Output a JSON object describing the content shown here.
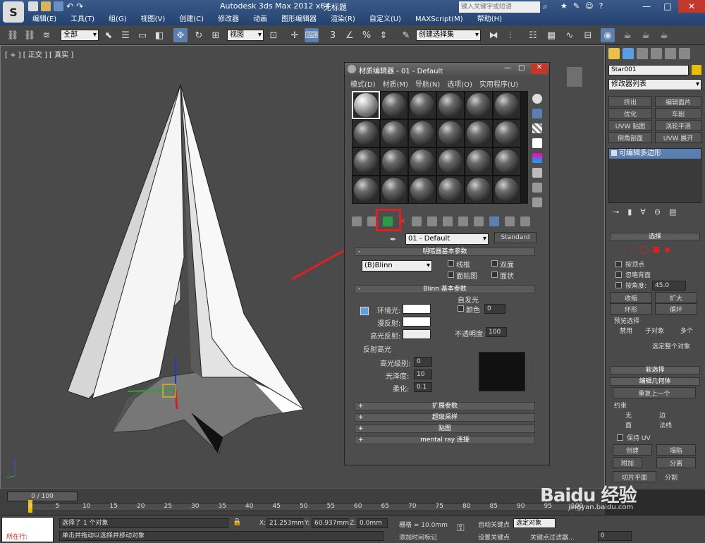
{
  "app": {
    "title": "Autodesk 3ds Max  2012 x64",
    "doc_title": "无标题",
    "search_placeholder": "键入关键字或短语"
  },
  "menu": [
    "编辑(E)",
    "工具(T)",
    "组(G)",
    "视图(V)",
    "创建(C)",
    "修改器",
    "动画",
    "图形编辑器",
    "渲染(R)",
    "自定义(U)",
    "MAXScript(M)",
    "帮助(H)"
  ],
  "toolbar": {
    "selection_filter": "全部",
    "coord_system": "视图",
    "selection_set": "创建选择集"
  },
  "viewport": {
    "label": "[ + ] [ 正交 ] [ 真实 ]"
  },
  "material_editor": {
    "title": "材质编辑器 - 01 - Default",
    "menus": [
      "模式(D)",
      "材质(M)",
      "导航(N)",
      "选项(O)",
      "实用程序(U)"
    ],
    "material_name": "01 - Default",
    "material_type": "Standard",
    "shader_rollout": "明暗器基本参数",
    "shader_type": "(B)Blinn",
    "checks": [
      "线框",
      "双面",
      "面贴图",
      "面状"
    ],
    "blinn_rollout": "Blinn 基本参数",
    "ambient": "环境光:",
    "diffuse": "漫反射:",
    "specular": "高光反射:",
    "self_illum": "自发光",
    "color_label": "颜色",
    "color_value": "0",
    "opacity_label": "不透明度:",
    "opacity_value": "100",
    "spec_highlights": "反射高光",
    "spec_level_label": "高光级别:",
    "spec_level": "0",
    "gloss_label": "光泽度:",
    "gloss": "10",
    "soften_label": "柔化:",
    "soften": "0.1",
    "rollouts": [
      "扩展参数",
      "超级采样",
      "贴图",
      "mental ray 连接"
    ]
  },
  "command_panel": {
    "object_name": "Star001",
    "modifier_list": "修改器列表",
    "modifier_buttons": [
      "挤出",
      "编辑面片",
      "优化",
      "车削",
      "UVW 贴图",
      "涡轮平滑",
      "倒角剖面",
      "UVW 展开"
    ],
    "stack_item": "可编辑多边形",
    "select_rollout": "选择",
    "by_vertex": "按顶点",
    "ignore_backface": "忽略背面",
    "by_angle": "按角度:",
    "angle_value": "45.0",
    "shrink": "收缩",
    "grow": "扩大",
    "ring": "环形",
    "loop": "循环",
    "preview_select": "预览选择",
    "preview_options": [
      "禁用",
      "子对象",
      "多个"
    ],
    "selected_whole": "选定整个对象",
    "soft_select": "软选择",
    "edit_geometry": "编辑几何体",
    "repeat_last": "重复上一个",
    "constraints": "约束",
    "constraint_options": [
      "无",
      "边",
      "面",
      "法线"
    ],
    "preserve_uv": "保持 UV",
    "create": "创建",
    "collapse": "塌陷",
    "attach": "附加",
    "detach": "分离",
    "slice_plane": "切片平面",
    "split": "分割",
    "reset_plane": "重置平面",
    "cut": "切割"
  },
  "timeline": {
    "frame": "0 / 100",
    "ticks": [
      "0",
      "5",
      "10",
      "15",
      "20",
      "25",
      "30",
      "35",
      "40",
      "45",
      "50",
      "55",
      "60",
      "65",
      "70",
      "75",
      "80",
      "85",
      "90",
      "95",
      "100"
    ]
  },
  "status": {
    "location": "所在行:",
    "selected": "选择了 1 个对象",
    "hint": "单击并拖动以选择并移动对象",
    "x_label": "X:",
    "x": "21.253mm",
    "y_label": "Y:",
    "y": "60.937mm",
    "z_label": "Z:",
    "z": "0.0mm",
    "grid": "栅格 = 10.0mm",
    "auto_key": "自动关键点",
    "selected_obj": "选定对象",
    "set_key": "设置关键点",
    "key_filters": "关键点过滤器...",
    "add_time_tag": "添加时间标记",
    "frame_value": "0",
    "watermark": "Baidu 经验",
    "watermark_url": "jingyan.baidu.com"
  }
}
